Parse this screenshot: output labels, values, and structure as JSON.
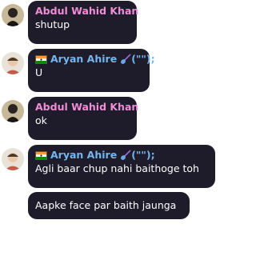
{
  "colors": {
    "bubble_bg": "#1e1b2a",
    "name_pink": "#ef8ed7",
    "name_blue": "#74b6ee",
    "message_text": "#ffffff"
  },
  "messages": [
    {
      "sender": "Abdul Wahid Khan",
      "sender_color": "pink",
      "avatar_icon": "dark-figure-avatar",
      "text": "shutup"
    },
    {
      "sender": "Aryan Ahire",
      "sender_color": "blue",
      "flag_icon": "india-flag-icon",
      "name_suffix_icon": "guitar-icon",
      "name_suffix": "(\"\");",
      "avatar_icon": "cartoon-avatar",
      "text": "U"
    },
    {
      "sender": "Abdul Wahid Khan",
      "sender_color": "pink",
      "avatar_icon": "dark-figure-avatar",
      "text": "ok"
    },
    {
      "sender": "Aryan Ahire",
      "sender_color": "blue",
      "flag_icon": "india-flag-icon",
      "name_suffix_icon": "guitar-icon",
      "name_suffix": "(\"\");",
      "avatar_icon": "cartoon-avatar",
      "text": "Agli baar chup nahi baithoge toh"
    },
    {
      "continuation": true,
      "text": "Aapke face par baith jaunga"
    }
  ]
}
